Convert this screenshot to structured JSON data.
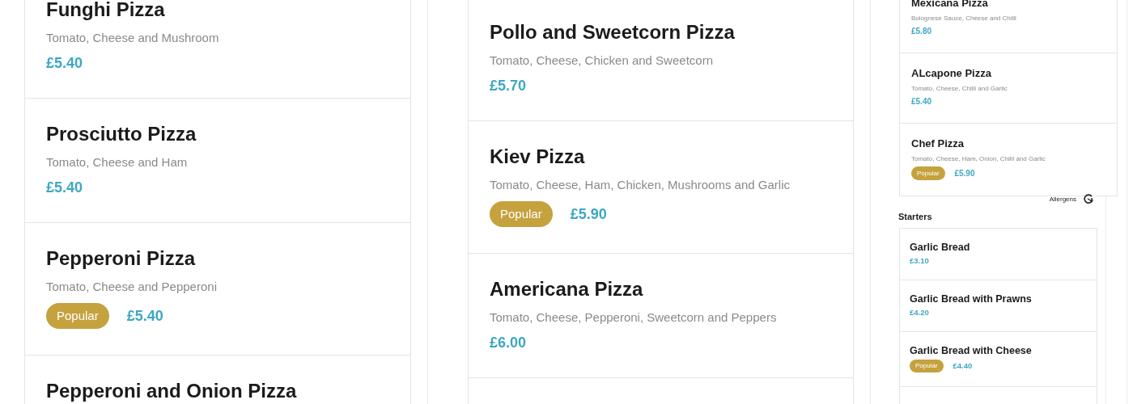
{
  "panels": [
    {
      "kind": "large",
      "items": [
        {
          "name": "Funghi Pizza",
          "description": "Tomato, Cheese and Mushroom",
          "price": "£5.40"
        },
        {
          "name": "Prosciutto Pizza",
          "description": "Tomato, Cheese and Ham",
          "price": "£5.40"
        },
        {
          "name": "Pepperoni Pizza",
          "description": "Tomato, Cheese and Pepperoni",
          "badge": "Popular",
          "price": "£5.40"
        },
        {
          "name": "Pepperoni and Onion Pizza"
        }
      ]
    },
    {
      "kind": "large",
      "items": [
        {
          "name": "Pollo and Sweetcorn Pizza",
          "description": "Tomato, Cheese, Chicken and Sweetcorn",
          "price": "£5.70"
        },
        {
          "name": "Kiev Pizza",
          "description": "Tomato, Cheese, Ham, Chicken, Mushrooms and Garlic",
          "badge": "Popular",
          "price": "£5.90"
        },
        {
          "name": "Americana Pizza",
          "description": "Tomato, Cheese, Pepperoni, Sweetcorn and Peppers",
          "price": "£6.00"
        }
      ]
    },
    {
      "kind": "small",
      "items": [
        {
          "name": "Mexicana Pizza",
          "description": "Bolognese Sauce, Cheese and Chilli",
          "price": "£5.80"
        },
        {
          "name": "ALcapone Pizza",
          "description": "Tomato, Cheese, Chilli and Garlic",
          "price": "£5.40"
        },
        {
          "name": "Chef Pizza",
          "description": "Tomato, Cheese, Ham, Onion, Chilli and Garlic",
          "badge": "Popular",
          "price": "£5.90"
        }
      ],
      "allergens": "Allergens",
      "section_title": "Starters",
      "starters": [
        {
          "name": "Garlic Bread",
          "price": "£3.10"
        },
        {
          "name": "Garlic Bread with Prawns",
          "price": "£4.20"
        },
        {
          "name": "Garlic Bread with Cheese",
          "badge": "Popular",
          "price": "£4.40"
        }
      ]
    }
  ]
}
